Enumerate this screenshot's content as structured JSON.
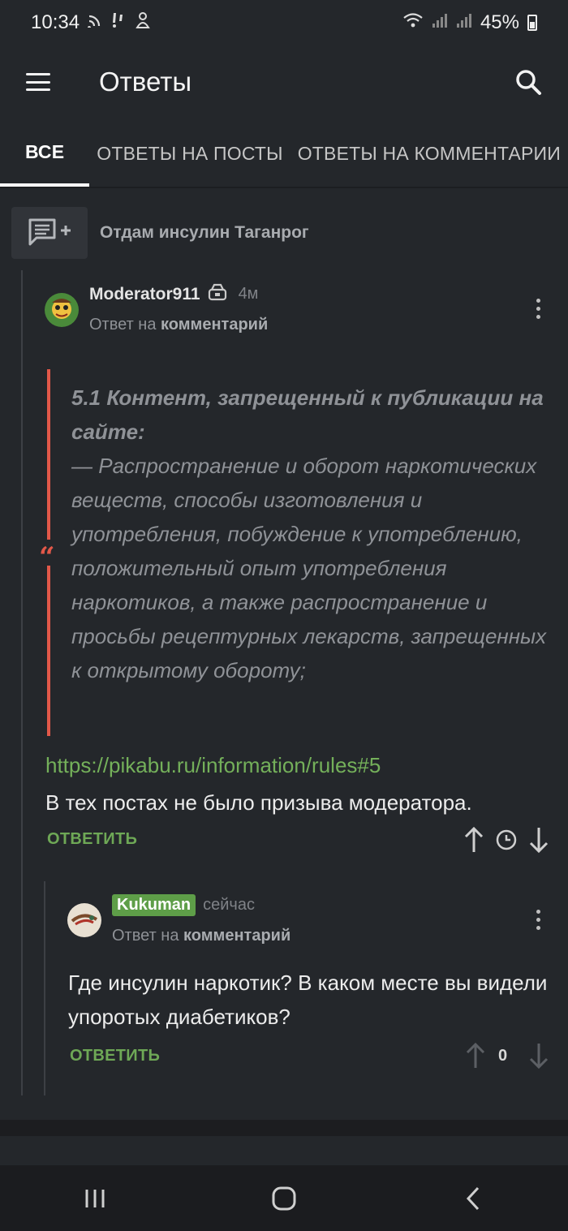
{
  "status_bar": {
    "time": "10:34",
    "battery": "45%"
  },
  "header": {
    "title": "Ответы"
  },
  "tabs": [
    {
      "label": "ВСЕ",
      "active": true
    },
    {
      "label": "ОТВЕТЫ НА ПОСТЫ",
      "active": false
    },
    {
      "label": "ОТВЕТЫ НА КОММЕНТАРИИ",
      "active": false
    }
  ],
  "post": {
    "title": "Отдам инсулин Таганрог"
  },
  "comments": [
    {
      "username": "Moderator911",
      "time": "4м",
      "reply_prefix": "Ответ на",
      "reply_target": "комментарий",
      "quote_heading": "5.1 Контент, запрещенный к публикации на сайте:",
      "quote_body": "— Распространение и оборот наркотических веществ, способы изготовления и употребления, побуждение к употреблению, положительный опыт употребления наркотиков, а также распространение и просьбы рецептурных лекарств, запрещенных к открытому обороту;",
      "link": "https://pikabu.ru/information/rules#5",
      "text": "В тех постах не было призыва модератора.",
      "reply_label": "ОТВЕТИТЬ"
    },
    {
      "username": "Kukuman",
      "time": "сейчас",
      "reply_prefix": "Ответ на",
      "reply_target": "комментарий",
      "text": "Где инсулин наркотик? В каком месте вы видели упоротых диабетиков?",
      "reply_label": "ОТВЕТИТЬ",
      "rating": "0"
    }
  ],
  "colors": {
    "accent_green": "#74b05a",
    "quote_red": "#e25849",
    "background": "#24272b"
  }
}
